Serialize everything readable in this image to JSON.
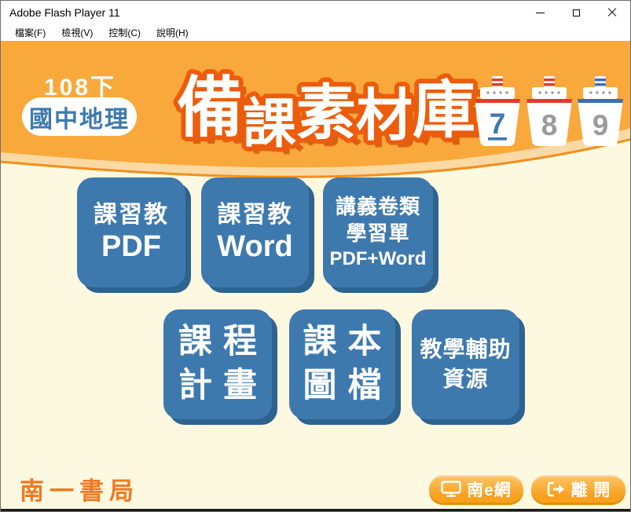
{
  "window": {
    "title": "Adobe Flash Player 11"
  },
  "menu": {
    "items": [
      "檔案(F)",
      "檢視(V)",
      "控制(C)",
      "說明(H)"
    ]
  },
  "header": {
    "edition": "108下",
    "subject": "國中地理",
    "title": "備課素材庫",
    "title_chars": [
      "備",
      "課",
      "素",
      "材",
      "庫"
    ],
    "boats": [
      {
        "number": "7",
        "accent": "red",
        "selected": true
      },
      {
        "number": "8",
        "accent": "red",
        "selected": false
      },
      {
        "number": "9",
        "accent": "blue",
        "selected": false
      }
    ]
  },
  "tiles": {
    "kexijiao_pdf": {
      "line1": "課習教",
      "line2": "PDF"
    },
    "kexijiao_word": {
      "line1": "課習教",
      "line2": "Word"
    },
    "handout_worksheet": {
      "line1": "講義卷類",
      "line2": "學習單",
      "line3": "PDF+Word"
    },
    "curriculum_plan": {
      "line1": "課程",
      "line2": "計畫"
    },
    "textbook_images": {
      "line1": "課本",
      "line2": "圖檔"
    },
    "teaching_resources": {
      "line1": "教學輔助",
      "line2": "資源"
    }
  },
  "footer": {
    "brand": "南一書局",
    "nan_e_net_label": "南e網",
    "exit_label": "離 開"
  },
  "icons": {
    "minimize": "minimize-icon",
    "maximize": "maximize-icon",
    "close": "close-icon",
    "monitor": "monitor-icon",
    "exit_arrow": "exit-arrow-icon"
  },
  "colors": {
    "header_orange": "#F9A93C",
    "wave_peach": "#FBD9A4",
    "wave_line": "#F08F1E",
    "body_cream": "#FDF9E1",
    "tile_blue": "#3E79AE",
    "tile_shadow": "#2E628F",
    "title_outline": "#ED5C0C",
    "button_orange": "#F9A01F",
    "brand_orange": "#F4791F",
    "boat_red": "#E23B2E",
    "boat_blue": "#3B6FB5",
    "number_gray": "#9B9B9B",
    "number_blue": "#3E79AE"
  }
}
